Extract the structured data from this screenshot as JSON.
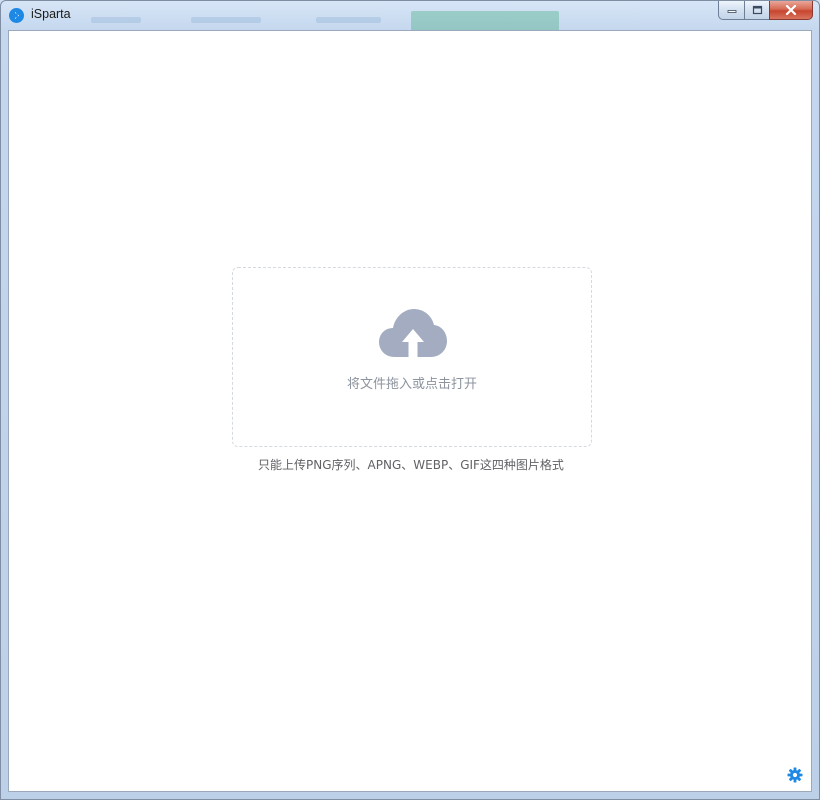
{
  "window": {
    "title": "iSparta",
    "buttons": {
      "minimize_icon": "minimize-icon",
      "maximize_icon": "maximize-icon",
      "close_icon": "close-icon"
    }
  },
  "upload": {
    "icon": "cloud-upload-icon",
    "drop_text": "将文件拖入或点击打开",
    "hint": "只能上传PNG序列、APNG、WEBP、GIF这四种图片格式"
  },
  "settings": {
    "icon": "gear-icon"
  },
  "colors": {
    "accent": "#1e88e5",
    "upload_icon": "#a3acc0",
    "close_button": "#c7452f"
  }
}
